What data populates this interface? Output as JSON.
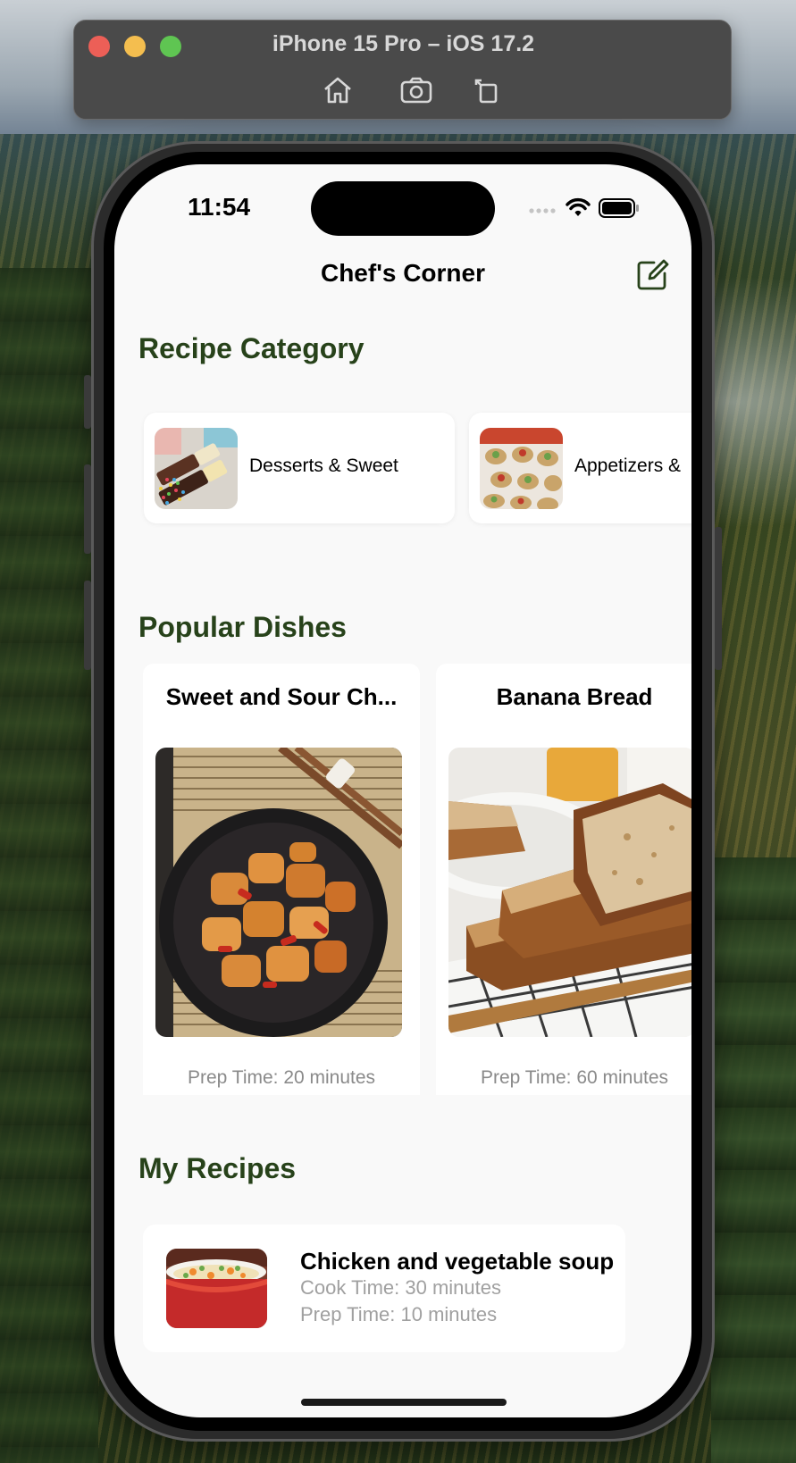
{
  "simulator": {
    "title": "iPhone 15 Pro – iOS 17.2",
    "tools": [
      "home-icon",
      "screenshot-icon",
      "rotate-icon"
    ]
  },
  "status_bar": {
    "time": "11:54"
  },
  "nav": {
    "title": "Chef's Corner",
    "action_icon": "compose-icon"
  },
  "sections": {
    "categories_title": "Recipe Category",
    "popular_title": "Popular Dishes",
    "my_recipes_title": "My Recipes"
  },
  "categories": [
    {
      "label": "Desserts & Sweet"
    },
    {
      "label": "Appetizers &"
    }
  ],
  "popular_dishes": [
    {
      "title": "Sweet and Sour Ch...",
      "prep": "Prep Time: 20 minutes"
    },
    {
      "title": "Banana Bread",
      "prep": "Prep Time: 60 minutes"
    }
  ],
  "my_recipes": [
    {
      "title": "Chicken and vegetable soup",
      "cook": "Cook Time: 30 minutes",
      "prep": "Prep Time: 10 minutes"
    }
  ],
  "colors": {
    "section_title": "#27421a",
    "screen_bg": "#f9f9f9",
    "muted_text": "#8a8a8a"
  }
}
